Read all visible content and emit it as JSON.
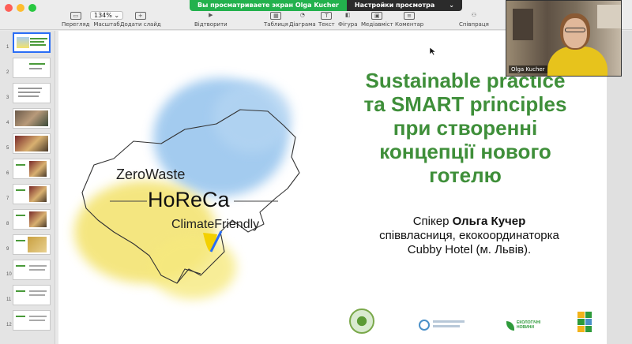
{
  "toolbar": {
    "items": [
      {
        "label": "Перегляд",
        "icon": "view-icon"
      },
      {
        "label": "Масштаб",
        "icon": "zoom-icon"
      },
      {
        "label": "Додати слайд",
        "icon": "add-slide-icon"
      },
      {
        "label": "Відтворити",
        "icon": "play-icon"
      },
      {
        "label": "Таблиця",
        "icon": "table-icon"
      },
      {
        "label": "Діаграма",
        "icon": "chart-icon"
      },
      {
        "label": "Текст",
        "icon": "text-icon"
      },
      {
        "label": "Фігура",
        "icon": "shape-icon"
      },
      {
        "label": "Медіавміст",
        "icon": "media-icon"
      },
      {
        "label": "Коментар",
        "icon": "comment-icon"
      },
      {
        "label": "Співпраця",
        "icon": "collaborate-icon"
      }
    ],
    "zoom_value": "134%"
  },
  "share_bar": {
    "viewing_text": "Вы просматриваете экран Olga Kucher",
    "settings_text": "Настройки просмотра"
  },
  "sidebar": {
    "slides": [
      "1",
      "2",
      "3",
      "4",
      "5",
      "6",
      "7",
      "8",
      "9",
      "10",
      "11",
      "12"
    ]
  },
  "slide": {
    "logo_lines": [
      "ZeroWaste",
      "HoReCa",
      "ClimateFriendly"
    ],
    "title_lines": [
      "Sustainable practice",
      "та SMART principles",
      "при створенні",
      "концепції нового",
      "готелю"
    ],
    "speaker_prefix": "Спікер ",
    "speaker_name": "Ольга Кучер",
    "speaker_role": "співвласниця, екокоординаторка",
    "speaker_org": "Cubby Hotel (м. Львів).",
    "footer_logo_text": "ЕКОЛОГІЧНІ НОВИНИ"
  },
  "webcam": {
    "name": "Olga Kucher"
  },
  "colors": {
    "title_green": "#3f8f3a",
    "share_green": "#23b14d",
    "selection_blue": "#2a6df5",
    "map_blue": "#9ac6ee",
    "map_yellow": "#f3e26a"
  }
}
